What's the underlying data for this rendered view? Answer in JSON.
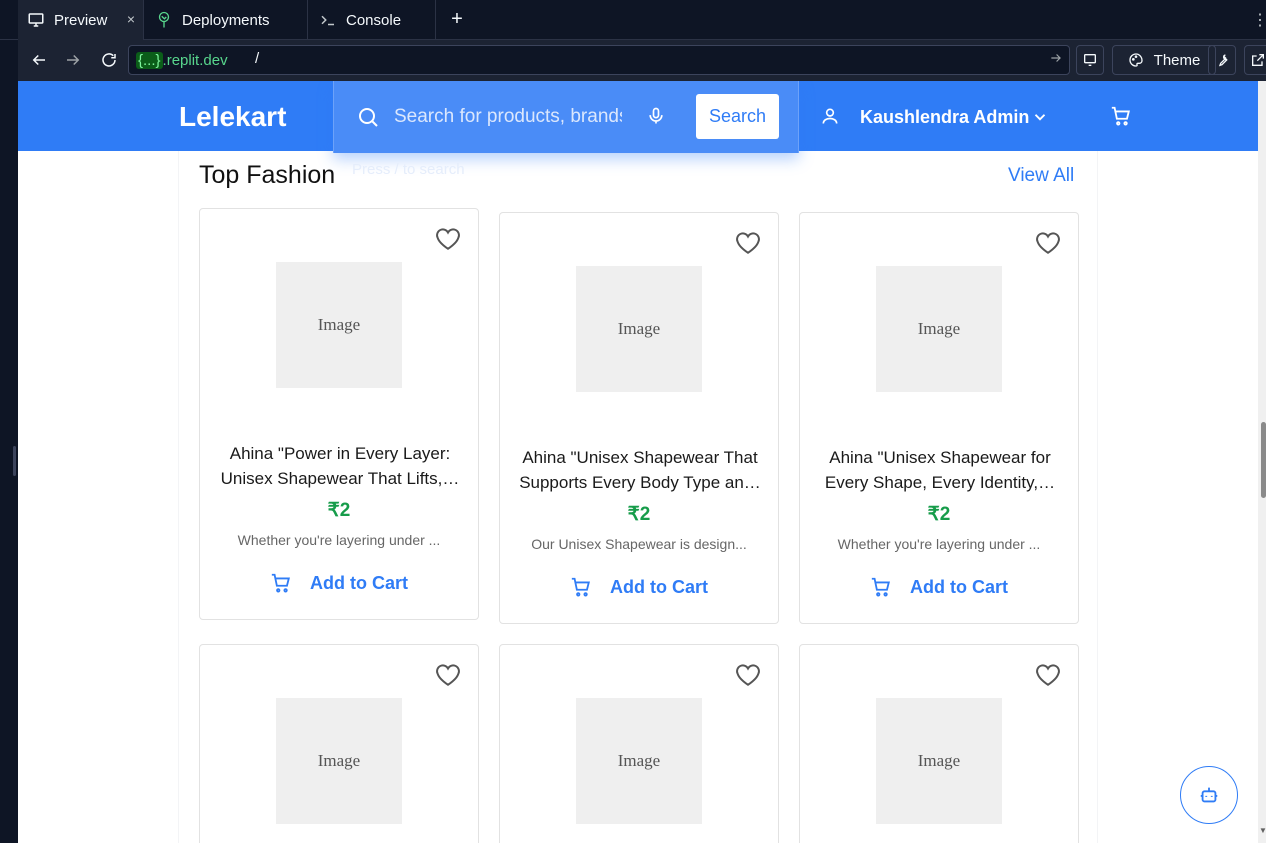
{
  "ide": {
    "tabs": [
      {
        "label": "Preview",
        "icon": "monitor-icon"
      },
      {
        "label": "Deployments",
        "icon": "deploy-tree-icon"
      },
      {
        "label": "Console",
        "icon": "terminal-icon"
      }
    ],
    "close_symbol": "×",
    "add_tab_symbol": "+",
    "more_symbol": "⋮",
    "url_host_braces": "{...}",
    "url_host_domain": ".replit.dev",
    "url_path": "/",
    "theme_label": "Theme"
  },
  "app": {
    "logo": "Lelekart",
    "search": {
      "placeholder": "Search for products, brands and more",
      "button_label": "Search",
      "hint": "Press / to search"
    },
    "user": {
      "name": "Kaushlendra Admin"
    },
    "accent_color": "#2f7cf6",
    "price_color": "#169c4a"
  },
  "section": {
    "title": "Top Fashion",
    "view_all_label": "View All"
  },
  "products": [
    {
      "image_label": "Image",
      "title_line1": "Ahina \"Power in Every Layer:",
      "title_line2": "Unisex Shapewear That Lifts,…",
      "price": "₹2",
      "description": "Whether you're layering under ...",
      "add_to_cart_label": "Add to Cart"
    },
    {
      "image_label": "Image",
      "title_line1": "Ahina \"Unisex Shapewear That",
      "title_line2": "Supports Every Body Type an…",
      "price": "₹2",
      "description": "Our Unisex Shapewear is design...",
      "add_to_cart_label": "Add to Cart"
    },
    {
      "image_label": "Image",
      "title_line1": "Ahina \"Unisex Shapewear for",
      "title_line2": "Every Shape, Every Identity,…",
      "price": "₹2",
      "description": "Whether you're layering under ...",
      "add_to_cart_label": "Add to Cart"
    },
    {
      "image_label": "Image"
    },
    {
      "image_label": "Image"
    },
    {
      "image_label": "Image"
    }
  ]
}
